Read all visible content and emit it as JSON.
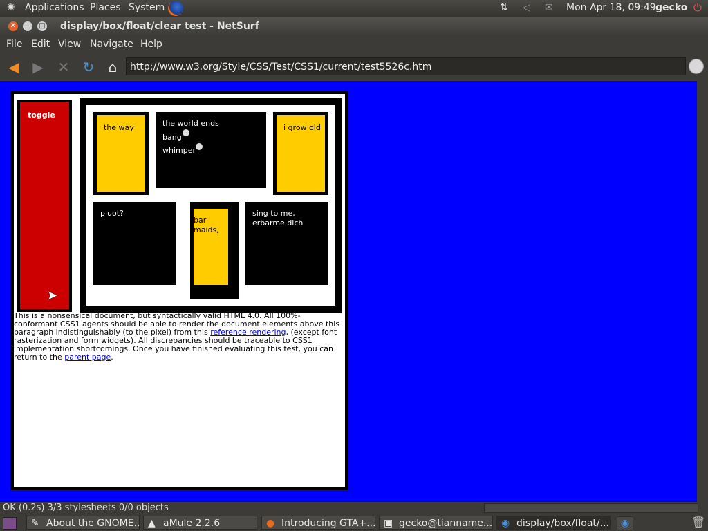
{
  "panel": {
    "applications": "Applications",
    "places": "Places",
    "system": "System",
    "clock": "Mon Apr 18, 09:49",
    "user": "gecko"
  },
  "window": {
    "title": "display/box/float/clear test  - NetSurf"
  },
  "menu": {
    "file": "File",
    "edit": "Edit",
    "view": "View",
    "navigate": "Navigate",
    "help": "Help"
  },
  "toolbar": {
    "url": "http://www.w3.org/Style/CSS/Test/CSS1/current/test5526c.htm"
  },
  "test": {
    "toggle": "toggle",
    "the_way": "the way",
    "world_ends": "the world ends",
    "bang": "bang",
    "whimper": "whimper",
    "grow_old": "i grow old",
    "pluot": "pluot?",
    "bar": "bar",
    "maids": "maids,",
    "sing_line1": "sing to me,",
    "sing_line2": "erbarme dich",
    "para_text1": "This is a nonsensical document, but syntactically valid HTML 4.0. All 100%-conformant CSS1 agents should be able to render the document elements above this paragraph indistinguishably (to the pixel) from this ",
    "para_link1": "reference rendering",
    "para_text2": ", (except font rasterization and form widgets). All discrepancies should be traceable to CSS1 implementation shortcomings. Once you have finished evaluating this test, you can return to the ",
    "para_link2": "parent page",
    "para_text3": "."
  },
  "status": {
    "text": "OK (0.2s) 3/3 stylesheets 0/0 objects"
  },
  "taskbar": {
    "t1": "About the GNOME...",
    "t2": "aMule 2.2.6",
    "t3": "Introducing GTA+...",
    "t4": "gecko@tianname...",
    "t5": "display/box/float/..."
  }
}
